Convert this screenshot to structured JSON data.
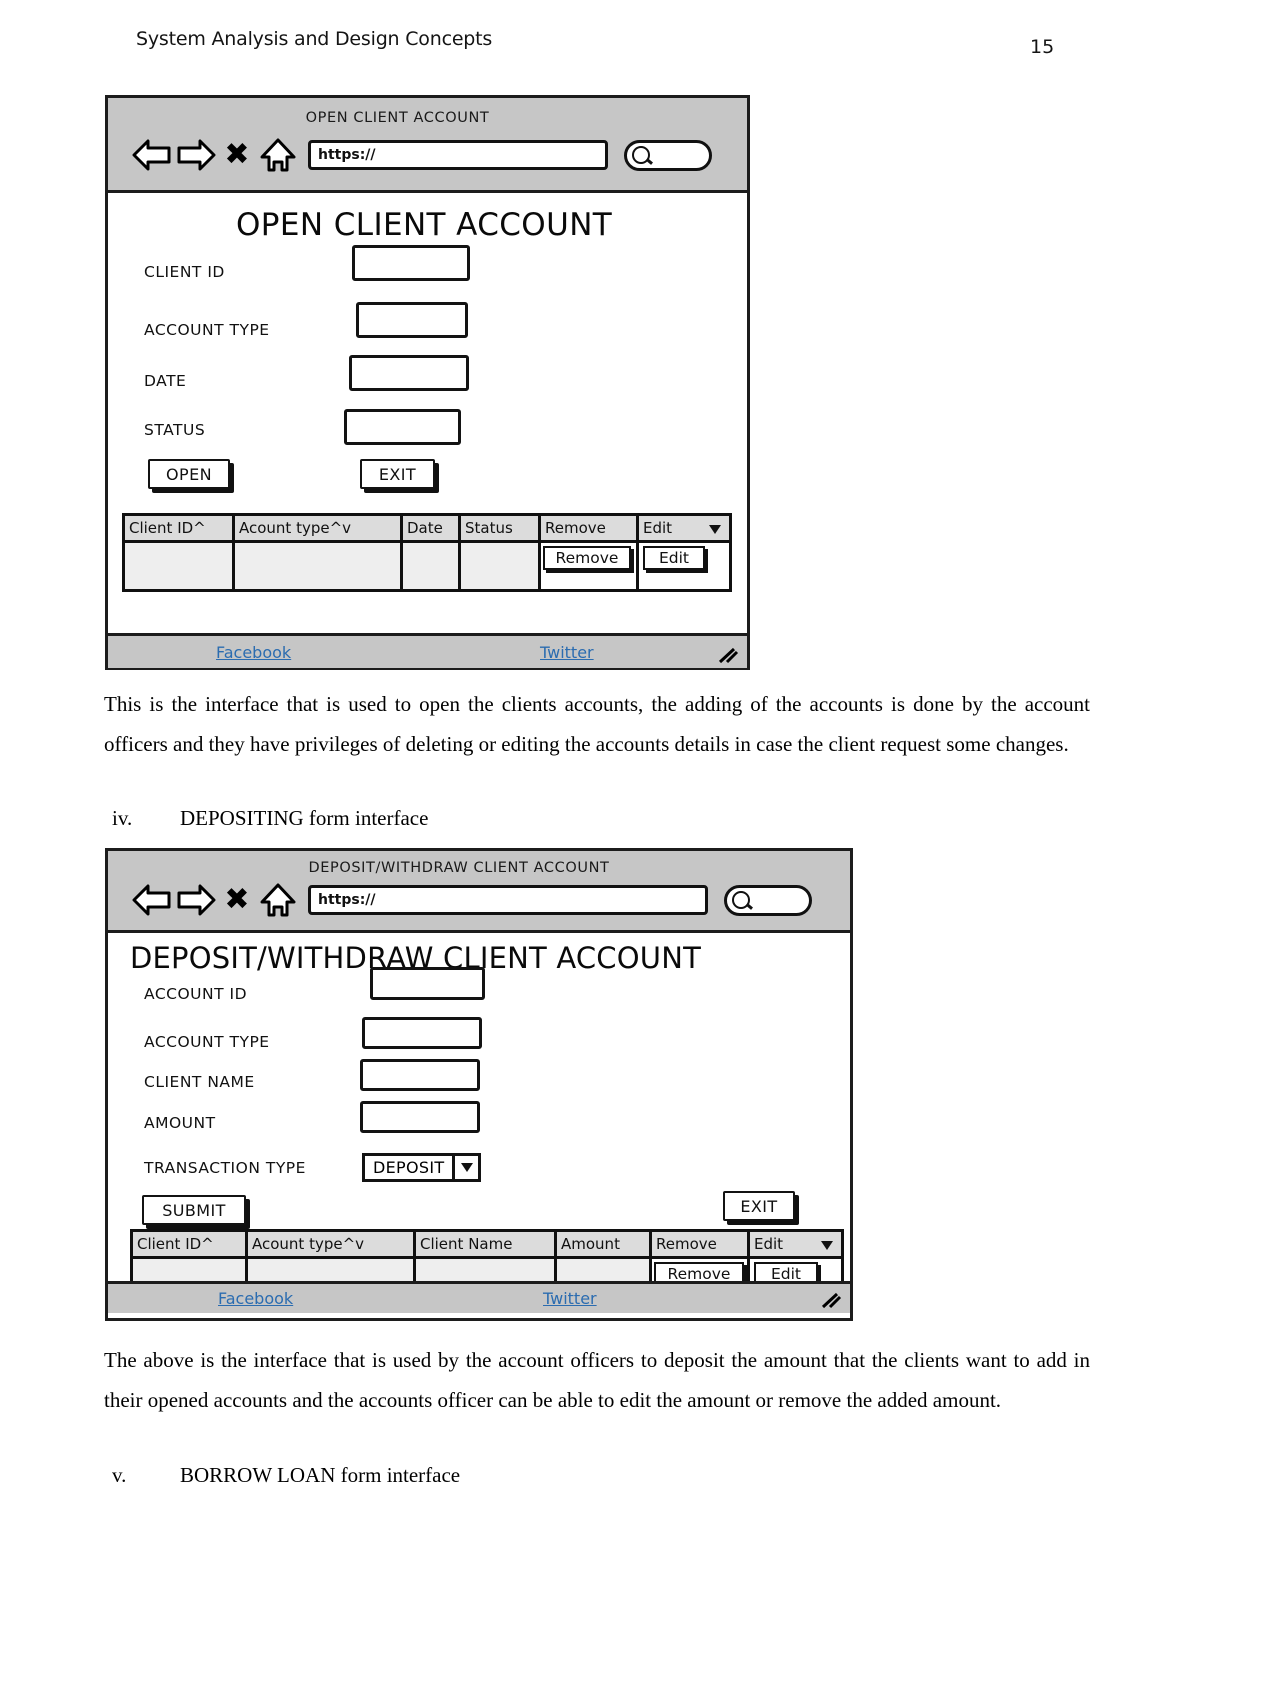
{
  "header": {
    "doc_title": "System Analysis and Design Concepts",
    "page_number": "15"
  },
  "mockup_open_account": {
    "chrome": {
      "title": "OPEN CLIENT ACCOUNT",
      "back_icon": "back-arrow-icon",
      "forward_icon": "forward-arrow-icon",
      "stop_icon": "close-x-icon",
      "home_icon": "home-icon",
      "url_value": "https://",
      "search_icon": "magnifier-icon"
    },
    "form_title": "OPEN CLIENT ACCOUNT",
    "fields": [
      {
        "label": "CLIENT ID",
        "value": ""
      },
      {
        "label": "ACCOUNT TYPE",
        "value": ""
      },
      {
        "label": "DATE",
        "value": ""
      },
      {
        "label": "STATUS",
        "value": ""
      }
    ],
    "buttons": {
      "primary": "OPEN",
      "exit": "EXIT"
    },
    "grid": {
      "headers": [
        "Client ID^",
        "Acount type^v",
        "Date",
        "Status",
        "Remove",
        "Edit"
      ],
      "row_actions": {
        "remove": "Remove",
        "edit": "Edit"
      },
      "rows": [
        [
          "",
          "",
          "",
          "",
          "",
          ""
        ]
      ]
    },
    "footer": {
      "facebook": "Facebook",
      "twitter": "Twitter",
      "grip_icon": "resize-grip-icon"
    }
  },
  "paragraph_one": "This is the interface that is used to open the clients accounts, the adding of the accounts is done by the account officers and they have privileges of deleting or editing the accounts details in case the client request some changes.",
  "list_item_iv": {
    "numeral": "iv.",
    "text": "DEPOSITING form interface"
  },
  "mockup_deposit": {
    "chrome": {
      "title": "DEPOSIT/WITHDRAW CLIENT ACCOUNT",
      "back_icon": "back-arrow-icon",
      "forward_icon": "forward-arrow-icon",
      "stop_icon": "close-x-icon",
      "home_icon": "home-icon",
      "url_value": "https://",
      "search_icon": "magnifier-icon"
    },
    "form_title": "DEPOSIT/WITHDRAW CLIENT ACCOUNT",
    "fields": [
      {
        "label": "ACCOUNT ID",
        "value": ""
      },
      {
        "label": "ACCOUNT TYPE",
        "value": ""
      },
      {
        "label": "CLIENT NAME",
        "value": ""
      },
      {
        "label": "AMOUNT",
        "value": ""
      }
    ],
    "transaction_type": {
      "label": "TRANSACTION TYPE",
      "value": "DEPOSIT"
    },
    "buttons": {
      "primary": "SUBMIT",
      "exit": "EXIT"
    },
    "grid": {
      "headers": [
        "Client ID^",
        "Acount type^v",
        "Client Name",
        "Amount",
        "Remove",
        "Edit"
      ],
      "row_actions": {
        "remove": "Remove",
        "edit": "Edit"
      },
      "rows": [
        [
          "",
          "",
          "",
          "",
          "",
          ""
        ]
      ]
    },
    "footer": {
      "facebook": "Facebook",
      "twitter": "Twitter",
      "grip_icon": "resize-grip-icon"
    }
  },
  "paragraph_two": "The above is the interface that is used by the account officers to deposit the amount that the clients want to add in their opened accounts and  the accounts officer can be able to edit the amount or remove the added amount.",
  "list_item_v": {
    "numeral": "v.",
    "text": "BORROW LOAN form interface"
  }
}
